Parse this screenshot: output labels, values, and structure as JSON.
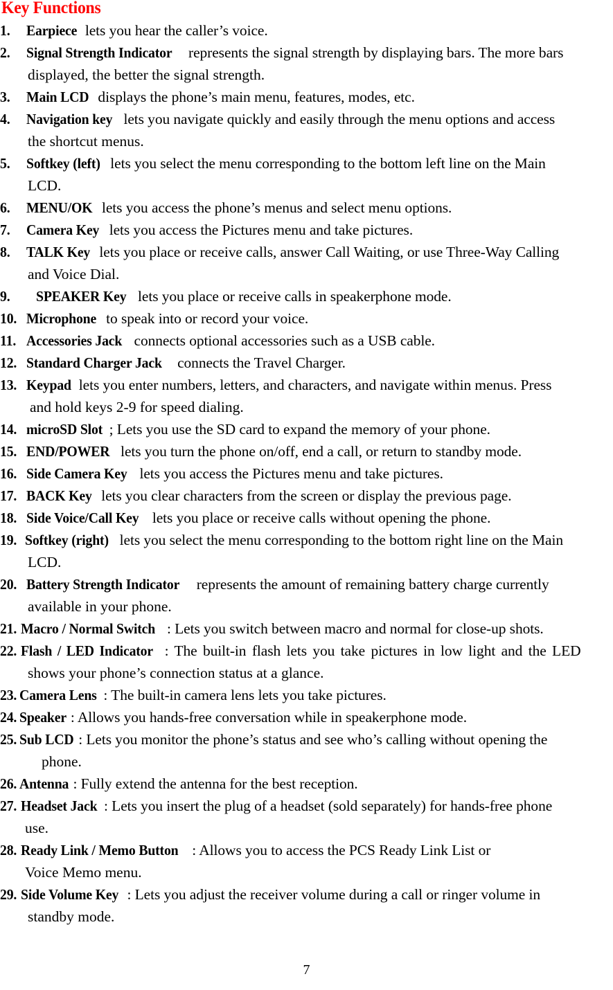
{
  "document": {
    "title": "Key Functions",
    "title_color": "#ff0000",
    "page_number": "7",
    "background_color": "#ffffff",
    "text_color": "#000000"
  },
  "items": [
    {
      "number": "1.",
      "term": "Earpiece",
      "rest": " lets you hear the caller’s voice.",
      "continuations": []
    },
    {
      "number": "2.",
      "term": "Signal Strength Indicator",
      "rest": " represents the signal strength by displaying bars. The more bars",
      "continuations": [
        "displayed, the better the signal strength."
      ]
    },
    {
      "number": "3.",
      "term": "Main LCD",
      "rest": " displays the phone’s main menu, features, modes, etc.",
      "continuations": []
    },
    {
      "number": "4.",
      "term": "Navigation key",
      "rest": " lets you navigate quickly and easily through the menu options and access",
      "continuations": [
        "the shortcut menus."
      ]
    },
    {
      "number": "5.",
      "term": "Softkey (left)",
      "rest": " lets you select the menu corresponding to the bottom left line on the Main",
      "continuations": [
        "LCD."
      ]
    },
    {
      "number": "6.",
      "term": "MENU/OK",
      "rest": " lets you access the phone’s menus and select menu options.",
      "continuations": []
    },
    {
      "number": "7.",
      "term": "Camera Key",
      "rest": " lets you access the Pictures menu and take pictures.",
      "continuations": []
    },
    {
      "number": "8.",
      "term": "TALK Key",
      "rest": " lets you place or receive calls, answer Call Waiting, or use Three-Way Calling",
      "continuations": [
        "and Voice Dial."
      ]
    },
    {
      "number": "9.",
      "term": "SPEAKER Key",
      "rest": " lets you place or receive calls in speakerphone mode.",
      "continuations": []
    },
    {
      "number": "10.",
      "term": "Microphone",
      "rest": " to speak into or record your voice.",
      "continuations": []
    },
    {
      "number": "11.",
      "term": "Accessories Jack",
      "rest": " connects optional accessories such as a USB cable.",
      "continuations": []
    },
    {
      "number": "12.",
      "term": "Standard Charger Jack",
      "rest": " connects the Travel Charger.",
      "continuations": []
    },
    {
      "number": "13.",
      "term": "Keypad",
      "rest": " lets you enter numbers, letters, and characters, and navigate within menus. Press",
      "continuations": [
        "and hold keys 2-9 for speed dialing."
      ]
    },
    {
      "number": "14.",
      "term": "microSD Slot",
      "rest": "; Lets you use the SD card to expand the memory of your phone.",
      "continuations": []
    },
    {
      "number": "15.",
      "term": "END/POWER",
      "rest": " lets you turn the phone on/off, end a call, or return to standby mode.",
      "continuations": []
    },
    {
      "number": "16.",
      "term": "Side Camera Key",
      "rest": " lets you access the Pictures menu and take pictures.",
      "continuations": []
    },
    {
      "number": "17.",
      "term": "BACK Key",
      "rest": " lets you clear characters from the screen or display the previous page.",
      "continuations": []
    },
    {
      "number": "18.",
      "term": "Side Voice/Call Key",
      "rest": " lets you place or receive calls without opening the phone.",
      "continuations": []
    },
    {
      "number": "19.",
      "term": "Softkey (right)",
      "rest": " lets you select the menu corresponding to the bottom right line on the Main",
      "continuations": [
        "LCD."
      ]
    },
    {
      "number": "20.",
      "term": "Battery Strength Indicator",
      "rest": " represents the amount of remaining battery charge currently",
      "continuations": [
        "available in your phone."
      ]
    },
    {
      "number": "21.",
      "term": "Macro / Normal Switch",
      "rest": ": Lets you switch between macro and normal for close-up shots.",
      "continuations": []
    },
    {
      "number": "22.",
      "term": "Flash / LED Indicator",
      "rest": ": The built-in flash lets you take pictures in low light and the LED",
      "continuations": [
        "shows your phone’s connection status at a glance."
      ]
    },
    {
      "number": "23.",
      "term": "Camera Lens",
      "rest": ": The built-in camera lens lets you take pictures.",
      "continuations": []
    },
    {
      "number": "24.",
      "term": "Speaker",
      "rest": ": Allows you hands-free conversation while in speakerphone mode.",
      "continuations": []
    },
    {
      "number": "25.",
      "term": "Sub LCD",
      "rest": ": Lets you monitor the phone’s status and see who’s calling without opening the",
      "continuations": [
        "phone."
      ]
    },
    {
      "number": "26.",
      "term": "Antenna",
      "rest": ": Fully extend the antenna for the best reception.",
      "continuations": []
    },
    {
      "number": "27.",
      "term": "Headset Jack",
      "rest": ": Lets you insert the plug of a headset (sold separately) for hands-free phone",
      "continuations": [
        "use."
      ]
    },
    {
      "number": "28.",
      "term": "Ready Link / Memo Button",
      "rest": ": Allows you to access the PCS Ready Link List or",
      "continuations": [
        "Voice Memo menu."
      ]
    },
    {
      "number": "29.",
      "term": "Side Volume Key",
      "rest": ": Lets you adjust the receiver volume during a call or ringer volume in",
      "continuations": [
        "standby mode."
      ]
    }
  ]
}
